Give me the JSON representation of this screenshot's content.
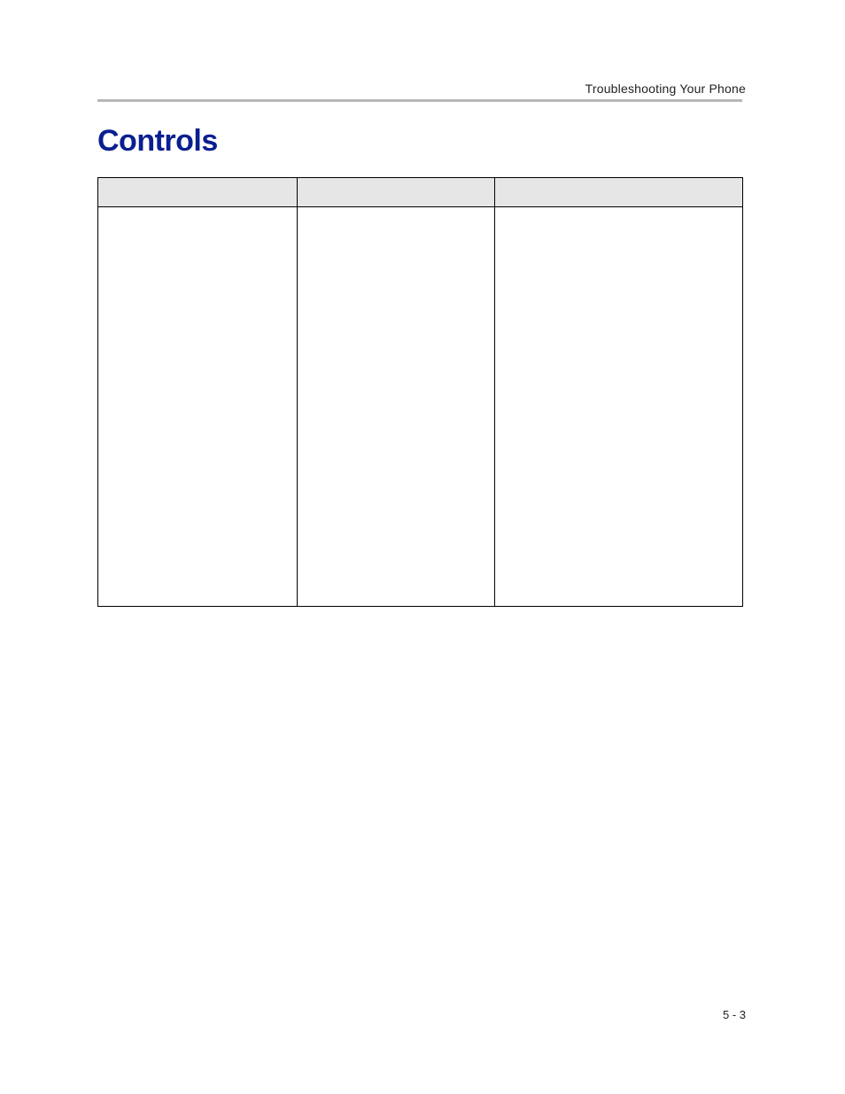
{
  "header": {
    "running_head": "Troubleshooting Your Phone"
  },
  "section": {
    "title": "Controls"
  },
  "table": {
    "headers": [
      "",
      "",
      ""
    ],
    "rows": [
      {
        "c1": "",
        "c2": "",
        "c3": ""
      }
    ]
  },
  "footer": {
    "page_number": "5 - 3"
  }
}
